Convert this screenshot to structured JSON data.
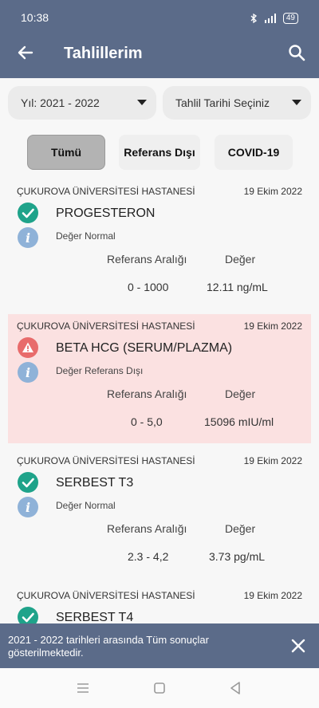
{
  "status_bar": {
    "time": "10:38",
    "battery": "49"
  },
  "header": {
    "title": "Tahlillerim",
    "back_icon": "arrow-left-icon",
    "search_icon": "search-icon"
  },
  "filters": {
    "year": "Yıl: 2021 - 2022",
    "date": "Tahlil Tarihi Seçiniz"
  },
  "tabs": [
    {
      "label": "Tümü",
      "active": true
    },
    {
      "label": "Referans Dışı",
      "active": false
    },
    {
      "label": "COVID-19",
      "active": false
    }
  ],
  "columns": {
    "reference": "Referans Aralığı",
    "value": "Değer"
  },
  "results": [
    {
      "hospital": "ÇUKUROVA ÜNİVERSİTESİ HASTANESİ",
      "date": "19 Ekim 2022",
      "name": "PROGESTERON",
      "status": "Değer Normal",
      "status_icon": "check-icon",
      "reference": "0 - 1000",
      "value": "12.11  ng/mL"
    },
    {
      "hospital": "ÇUKUROVA ÜNİVERSİTESİ HASTANESİ",
      "date": "19 Ekim 2022",
      "name": "BETA HCG (SERUM/PLAZMA)",
      "status": "Değer Referans Dışı",
      "status_icon": "warning-icon",
      "reference": "0 - 5,0",
      "value": "15096 mIU/ml"
    },
    {
      "hospital": "ÇUKUROVA ÜNİVERSİTESİ HASTANESİ",
      "date": "19 Ekim 2022",
      "name": "SERBEST T3",
      "status": "Değer Normal",
      "status_icon": "check-icon",
      "reference": "2.3 - 4,2",
      "value": "3.73  pg/mL"
    },
    {
      "hospital": "ÇUKUROVA ÜNİVERSİTESİ HASTANESİ",
      "date": "19 Ekim 2022",
      "name": "SERBEST T4",
      "status": "",
      "status_icon": "check-icon",
      "reference": "",
      "value": ""
    }
  ],
  "snackbar": {
    "message": "2021 - 2022 tarihleri arasında Tüm sonuçlar gösterilmektedir."
  },
  "colors": {
    "header": "#5b6b89",
    "normal": "#1fa38a",
    "out_of_range": "#e86b6b",
    "out_of_range_bg": "#fbe1e1",
    "info": "#8fb2d8"
  }
}
